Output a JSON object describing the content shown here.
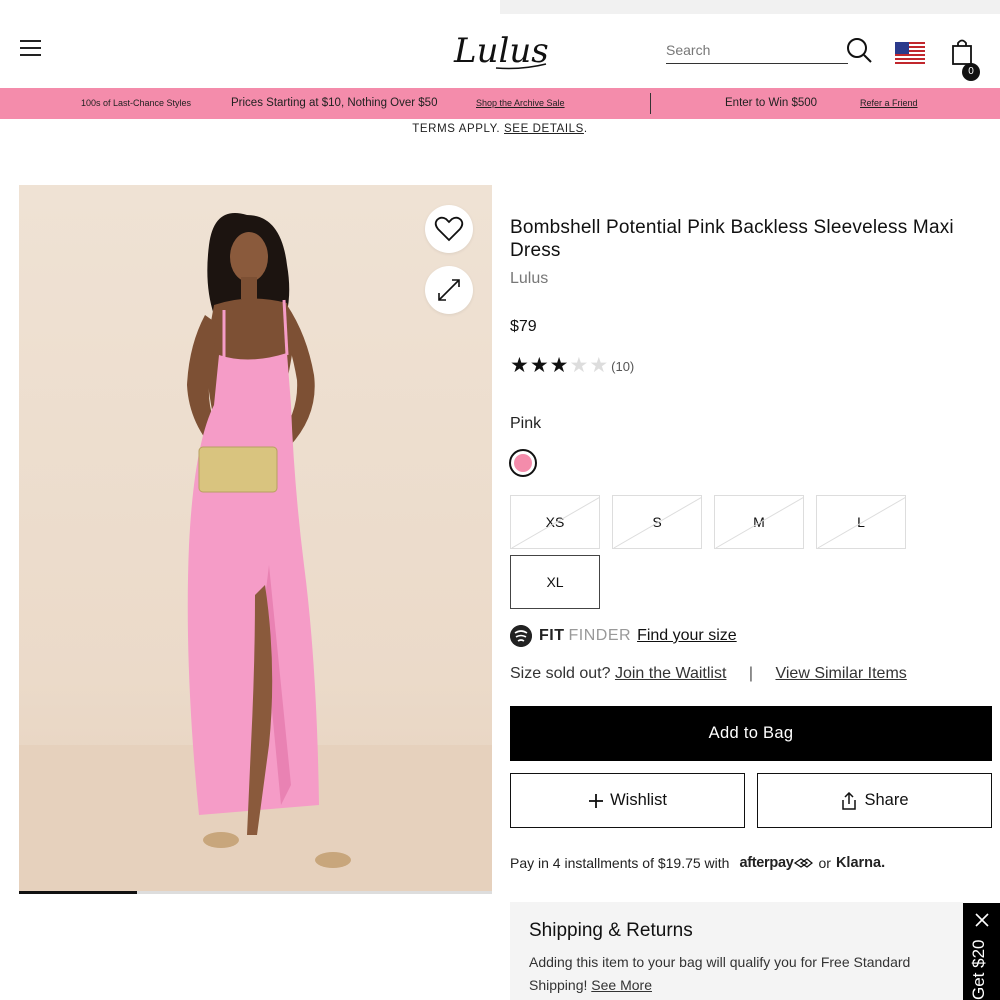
{
  "header": {
    "logo_text": "Lulus",
    "search_placeholder": "Search",
    "bag_count": "0"
  },
  "promo": {
    "item1": "100s of Last-Chance Styles",
    "item2": "Prices Starting at $10, Nothing Over $50",
    "item3": "Shop the Archive Sale",
    "item4": "Enter to Win $500",
    "item5": "Refer a Friend",
    "color": "#f48cab"
  },
  "terms": {
    "text": "TERMS APPLY.",
    "link": "SEE DETAILS"
  },
  "gallery": {
    "progress_fraction": 0.25
  },
  "product": {
    "title": "Bombshell Potential Pink Backless Sleeveless Maxi Dress",
    "brand": "Lulus",
    "price": "$79",
    "rating": 3,
    "rating_max": 5,
    "review_count": "(10)",
    "color_label": "Pink",
    "swatch_color": "#f48cab",
    "sizes": [
      {
        "label": "XS",
        "sold_out": true
      },
      {
        "label": "S",
        "sold_out": true
      },
      {
        "label": "M",
        "sold_out": true
      },
      {
        "label": "L",
        "sold_out": true
      },
      {
        "label": "XL",
        "sold_out": false
      }
    ]
  },
  "fitfinder": {
    "fit": "FIT",
    "finder": "FINDER",
    "link": "Find your size"
  },
  "soldout": {
    "text": "Size sold out?",
    "waitlist": "Join the Waitlist",
    "separator": "|",
    "similar": "View Similar Items"
  },
  "buttons": {
    "add_to_bag": "Add to Bag",
    "wishlist": "Wishlist",
    "share": "Share"
  },
  "payment": {
    "text": "Pay in 4 installments of $19.75 with",
    "afterpay": "afterpay",
    "or": "or",
    "klarna": "Klarna."
  },
  "shipping": {
    "title": "Shipping & Returns",
    "text": "Adding this item to your bag will qualify you for",
    "bold": "Free Standard Shipping!",
    "link": "See More"
  },
  "gettab": {
    "label": "Get $20"
  }
}
